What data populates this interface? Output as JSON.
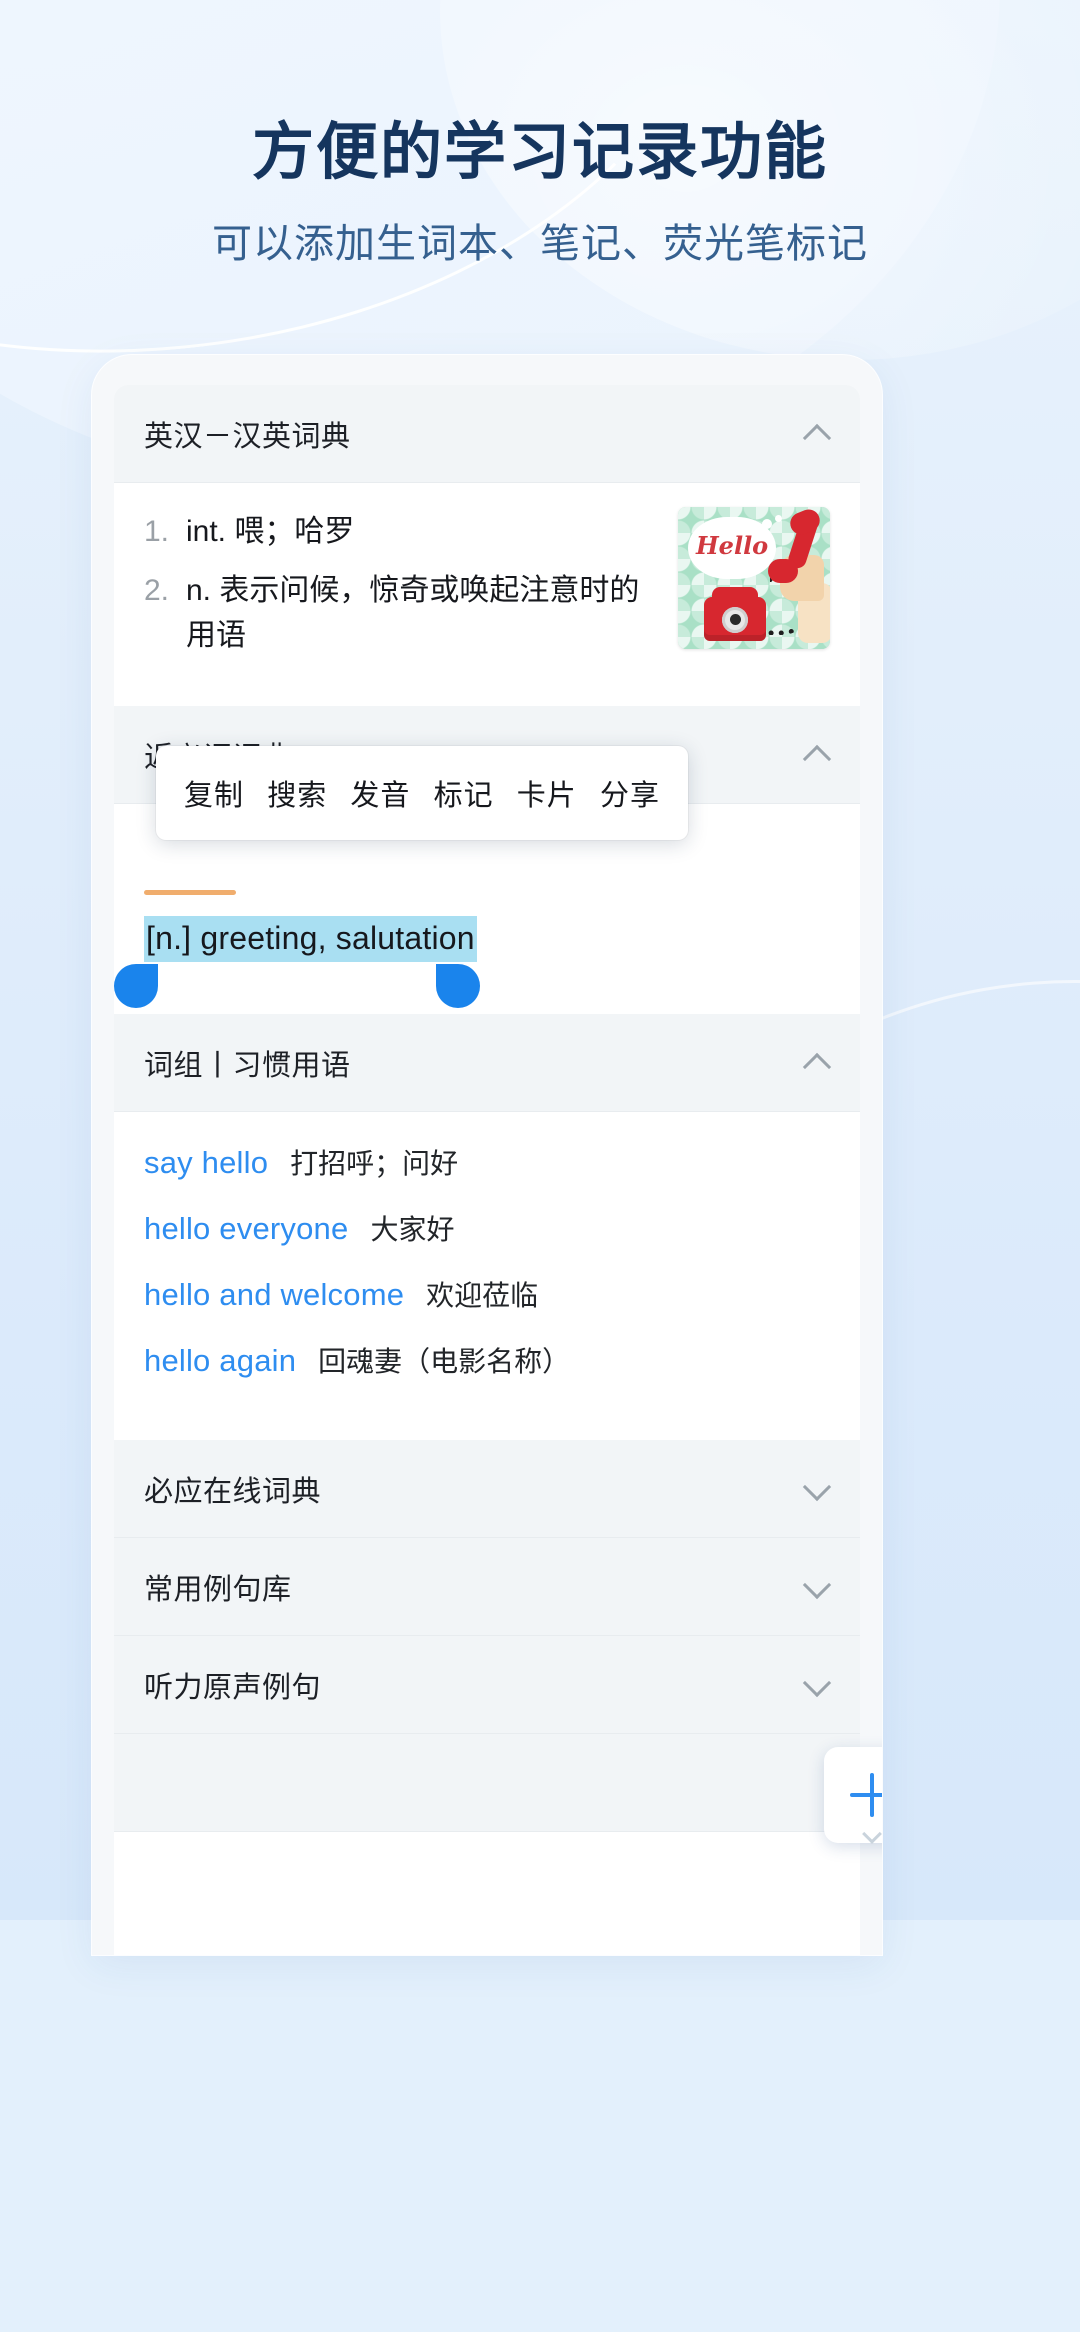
{
  "header": {
    "title": "方便的学习记录功能",
    "subtitle": "可以添加生词本、笔记、荧光笔标记"
  },
  "colors": {
    "title": "#15355e",
    "subtitle": "#35608f",
    "accent_link": "#2e8df0",
    "selection_highlight": "#a9dff2",
    "selection_handle": "#1a84ec",
    "tab_underline": "#f0ad6d",
    "background": "#e3f0fc"
  },
  "sections": [
    {
      "id": "ec-ce-dict",
      "title": "英汉－汉英词典",
      "expanded": true,
      "chevron": "chevron-up-icon"
    },
    {
      "id": "synonym-dict",
      "title": "近义词词典",
      "expanded": true,
      "chevron": "chevron-up-icon"
    },
    {
      "id": "phrases",
      "title": "词组丨习惯用语",
      "expanded": true,
      "chevron": "chevron-up-icon"
    },
    {
      "id": "bing-online-dict",
      "title": "必应在线词典",
      "expanded": false,
      "chevron": "chevron-down-icon"
    },
    {
      "id": "common-sentences",
      "title": "常用例句库",
      "expanded": false,
      "chevron": "chevron-down-icon"
    },
    {
      "id": "listening-sentences",
      "title": "听力原声例句",
      "expanded": false,
      "chevron": "chevron-down-icon"
    }
  ],
  "definitions": [
    {
      "num": "1.",
      "text": "int. 喂；哈罗"
    },
    {
      "num": "2.",
      "text": "n. 表示问候，惊奇或唤起注意时的用语"
    }
  ],
  "thumbnail": {
    "name": "hello-telephone-illustration",
    "caption": "Hello"
  },
  "context_menu": {
    "items": [
      "复制",
      "搜索",
      "发音",
      "标记",
      "卡片",
      "分享"
    ]
  },
  "selection": {
    "text": "[n.] greeting, salutation"
  },
  "phrases": [
    {
      "en": "say hello",
      "cn": "打招呼；问好"
    },
    {
      "en": "hello everyone",
      "cn": "大家好"
    },
    {
      "en": "hello and welcome",
      "cn": "欢迎莅临"
    },
    {
      "en": "hello again",
      "cn": "回魂妻（电影名称）"
    }
  ],
  "fab": {
    "name": "add-button",
    "label": "+"
  }
}
